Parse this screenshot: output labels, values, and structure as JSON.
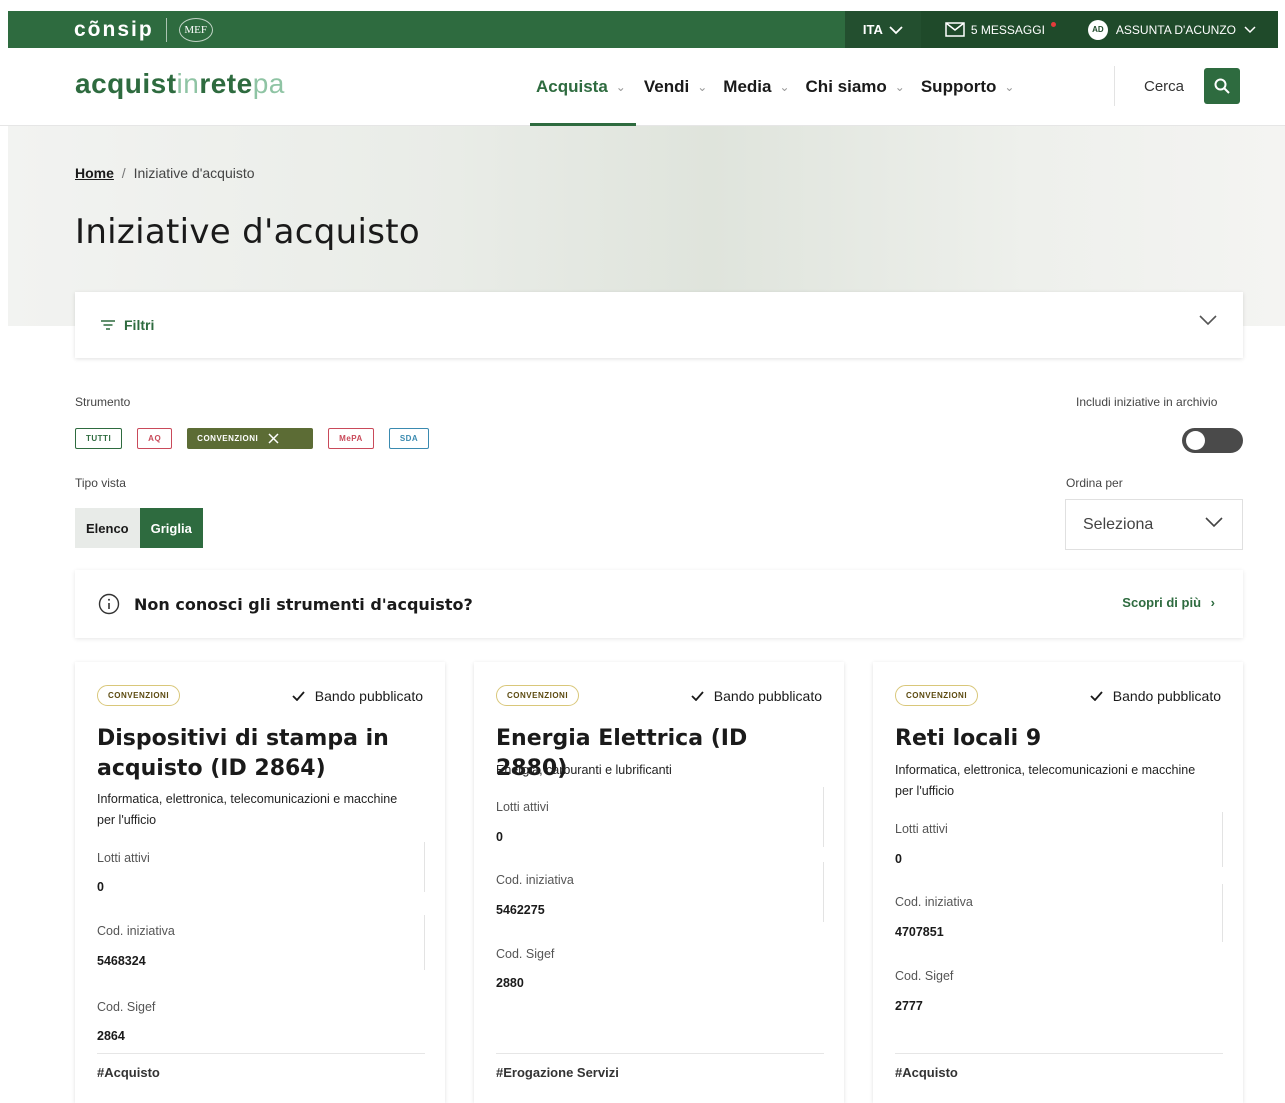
{
  "topbar": {
    "brand": "cõnsip",
    "mef": "MEF",
    "language": "ITA",
    "messages": "5 MESSAGGI",
    "user_initials": "AD",
    "user_name": "ASSUNTA D'ACUNZO"
  },
  "header": {
    "logo_part1": "acquist",
    "logo_part2": "in",
    "logo_part3": "rete",
    "logo_part4": "pa",
    "nav": [
      "Acquista",
      "Vendi",
      "Media",
      "Chi siamo",
      "Supporto"
    ],
    "search_label": "Cerca"
  },
  "breadcrumb": {
    "home": "Home",
    "separator": "/",
    "current": "Iniziative d'acquisto"
  },
  "page_title": "Iniziative d'acquisto",
  "filters": {
    "label": "Filtri"
  },
  "strumento": {
    "label": "Strumento",
    "chips": [
      "TUTTI",
      "AQ",
      "CONVENZIONI",
      "MePA",
      "SDA"
    ],
    "selected": "CONVENZIONI"
  },
  "archive": {
    "label": "Includi iniziative in archivio"
  },
  "view": {
    "label": "Tipo vista",
    "options": [
      "Elenco",
      "Griglia"
    ],
    "selected": "Griglia"
  },
  "sort": {
    "label": "Ordina per",
    "value": "Seleziona"
  },
  "info": {
    "text": "Non conosci gli strumenti d'acquisto?",
    "link": "Scopri di più"
  },
  "cards": [
    {
      "badge": "CONVENZIONI",
      "status": "Bando pubblicato",
      "title": "Dispositivi di stampa in acquisto (ID 2864)",
      "category": "Informatica, elettronica, telecomunicazioni e macchine per l'ufficio",
      "lotti_label": "Lotti attivi",
      "lotti_value": "0",
      "cod_label": "Cod. iniziativa",
      "cod_value": "5468324",
      "sigef_label": "Cod. Sigef",
      "sigef_value": "2864",
      "tag": "#Acquisto"
    },
    {
      "badge": "CONVENZIONI",
      "status": "Bando pubblicato",
      "title": "Energia Elettrica (ID 2880)",
      "category": "Energia, carburanti e lubrificanti",
      "lotti_label": "Lotti attivi",
      "lotti_value": "0",
      "cod_label": "Cod. iniziativa",
      "cod_value": "5462275",
      "sigef_label": "Cod. Sigef",
      "sigef_value": "2880",
      "tag": "#Erogazione Servizi"
    },
    {
      "badge": "CONVENZIONI",
      "status": "Bando pubblicato",
      "title": "Reti locali 9",
      "category": "Informatica, elettronica, telecomunicazioni e macchine per l'ufficio",
      "lotti_label": "Lotti attivi",
      "lotti_value": "0",
      "cod_label": "Cod. iniziativa",
      "cod_value": "4707851",
      "sigef_label": "Cod. Sigef",
      "sigef_value": "2777",
      "tag": "#Acquisto"
    }
  ]
}
